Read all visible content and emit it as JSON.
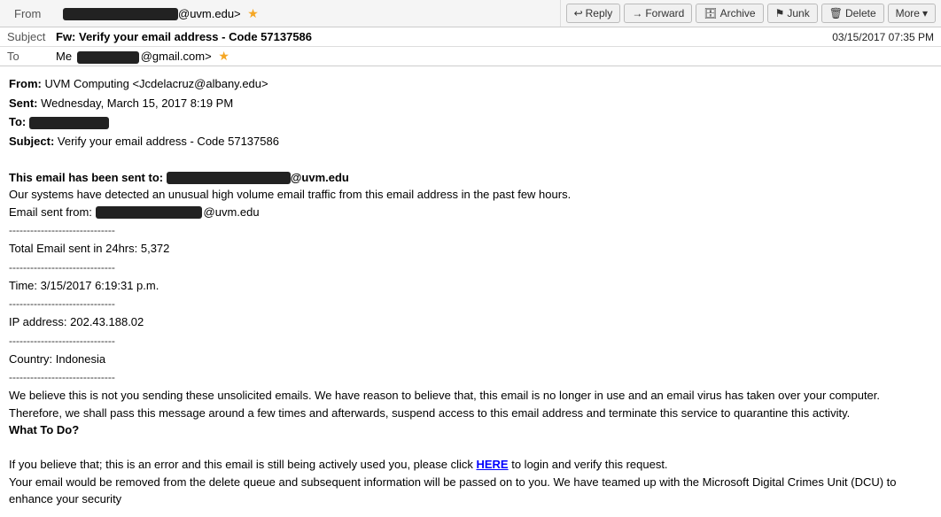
{
  "toolbar": {
    "reply_label": "Reply",
    "forward_label": "Forward",
    "archive_label": "Archive",
    "junk_label": "Junk",
    "delete_label": "Delete",
    "more_label": "More"
  },
  "header": {
    "from_label": "From",
    "from_redacted": "████████████████",
    "from_domain": "@uvm.edu>",
    "subject_label": "Subject",
    "subject_text": "Fw: Verify your email address - Code 57137586",
    "to_label": "To",
    "to_me": "Me",
    "to_redacted": "████████",
    "to_domain": "@gmail.com>",
    "date": "03/15/2017 07:35 PM"
  },
  "body": {
    "from_line_label": "From:",
    "from_line_value": "UVM Computing <Jcdelacruz@albany.edu>",
    "sent_label": "Sent:",
    "sent_value": "Wednesday, March 15, 2017 8:19 PM",
    "to_meta_label": "To:",
    "to_meta_redacted": "████████████",
    "subject_meta_label": "Subject:",
    "subject_meta_value": "Verify your email address - Code 57137586",
    "intro_bold": "This email has been sent to:",
    "intro_redacted": "████████████████████",
    "intro_domain": "@uvm.edu",
    "desc1": "Our systems have detected an unusual high volume email traffic from this email address in the past few hours.",
    "email_sent_from_label": "Email sent from:",
    "email_sent_redacted": "████████████████",
    "email_sent_domain": "@uvm.edu",
    "divider1": "------------------------------",
    "total_email_label": "Total Email sent in 24hrs: 5,372",
    "divider2": "------------------------------",
    "time_label": "Time: 3/15/2017 6:19:31 p.m.",
    "divider3": "------------------------------",
    "ip_label": "IP address: 202.43.188.02",
    "divider4": "------------------------------",
    "country_label": "Country: Indonesia",
    "divider5": "------------------------------",
    "para1": "We believe this is not you sending these unsolicited emails. We have reason to believe that, this email is no longer in use and an email virus has taken over your computer.",
    "para2": "Therefore, we shall pass this message around a few times and afterwards, suspend access to this email address and terminate this service to quarantine this activity.",
    "what_label": "What To Do?",
    "para3_pre": "If you believe that; this is an error and this email is still being actively used you, please click ",
    "here_link": "HERE",
    "para3_post": " to login and verify this request.",
    "para4": "Your email would be removed from the delete queue and subsequent information will be passed on to you. We have teamed up with the Microsoft Digital Crimes Unit (DCU) to enhance your security"
  }
}
